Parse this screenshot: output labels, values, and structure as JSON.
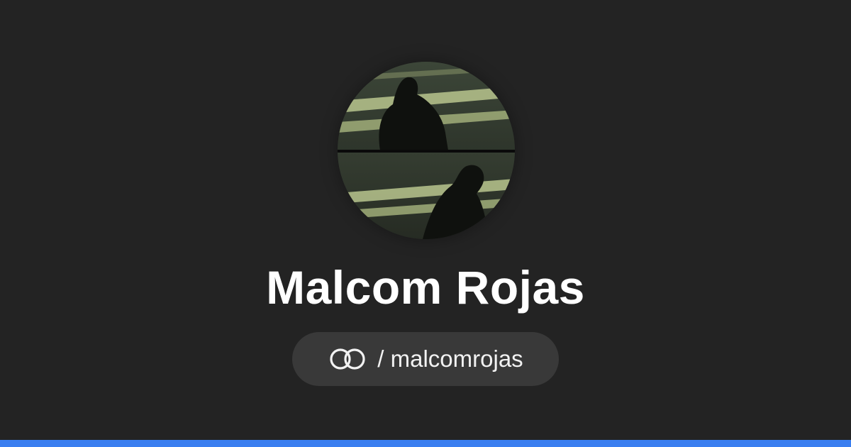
{
  "profile": {
    "display_name": "Malcom Rojas",
    "handle": "/ malcomrojas",
    "logo_icon": "linked-rings-icon",
    "avatar_description": "shadow-photo-avatar"
  },
  "colors": {
    "background": "#232323",
    "pill_background": "#393939",
    "text": "#ffffff",
    "accent_bar": "#3a7ef0"
  }
}
